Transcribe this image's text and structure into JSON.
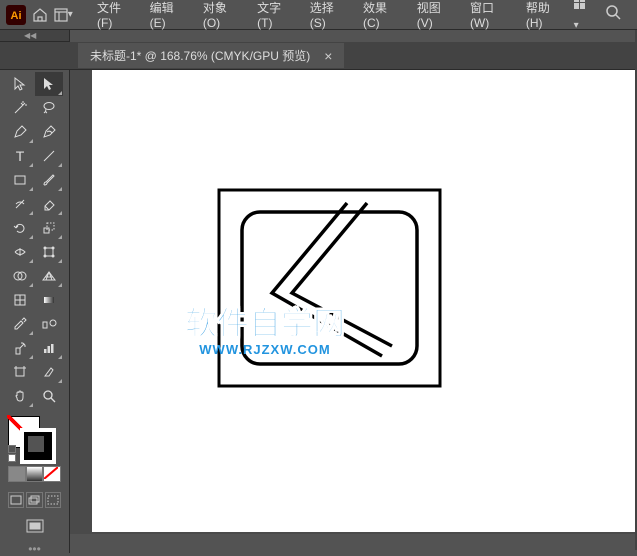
{
  "app": {
    "name": "Adobe Illustrator"
  },
  "menu": {
    "file": "文件(F)",
    "edit": "编辑(E)",
    "object": "对象(O)",
    "type": "文字(T)",
    "select": "选择(S)",
    "effect": "效果(C)",
    "view": "视图(V)",
    "window": "窗口(W)",
    "help": "帮助(H)"
  },
  "tab": {
    "title": "未标题-1* @ 168.76% (CMYK/GPU 预览)",
    "close": "×"
  },
  "tools": {
    "selection": "selection",
    "direct_selection": "direct-selection",
    "magic_wand": "magic-wand",
    "lasso": "lasso",
    "pen": "pen",
    "curvature": "curvature",
    "type": "type",
    "line": "line",
    "rectangle": "rectangle",
    "paintbrush": "paintbrush",
    "shaper": "shaper",
    "eraser": "eraser",
    "rotate": "rotate",
    "scale": "scale",
    "width": "width",
    "free_transform": "free-transform",
    "shape_builder": "shape-builder",
    "perspective": "perspective",
    "mesh": "mesh",
    "gradient": "gradient",
    "eyedropper": "eyedropper",
    "blend": "blend",
    "symbol_sprayer": "symbol-sprayer",
    "column_graph": "column-graph",
    "artboard": "artboard",
    "slice": "slice",
    "hand": "hand",
    "zoom": "zoom"
  },
  "watermark": {
    "main": "软件自学网",
    "sub": "WWW.RJZXW.COM"
  },
  "colors": {
    "fill": "none",
    "stroke": "#000000"
  }
}
